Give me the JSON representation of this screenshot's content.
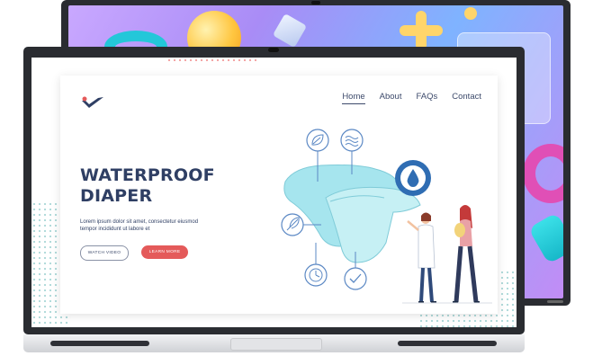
{
  "nav": {
    "home": "Home",
    "about": "About",
    "faqs": "FAQs",
    "contact": "Contact"
  },
  "hero": {
    "title_line1": "WATERPROOF",
    "title_line2": "DIAPER",
    "body": "Lorem ipsum dolor sit amet, consectetur eiusmod tempor incididunt ut labore et",
    "watch_label": "WATCH VIDEO",
    "learn_label": "LEARN MORE"
  },
  "colors": {
    "navy": "#2f3f64",
    "accent_red": "#e45a5a",
    "icon_blue": "#2f6db3",
    "diaper_teal": "#9ee3ec"
  },
  "icons": [
    "leaf-icon",
    "waves-icon",
    "water-drop-icon",
    "feather-icon",
    "timer-icon",
    "check-icon"
  ]
}
